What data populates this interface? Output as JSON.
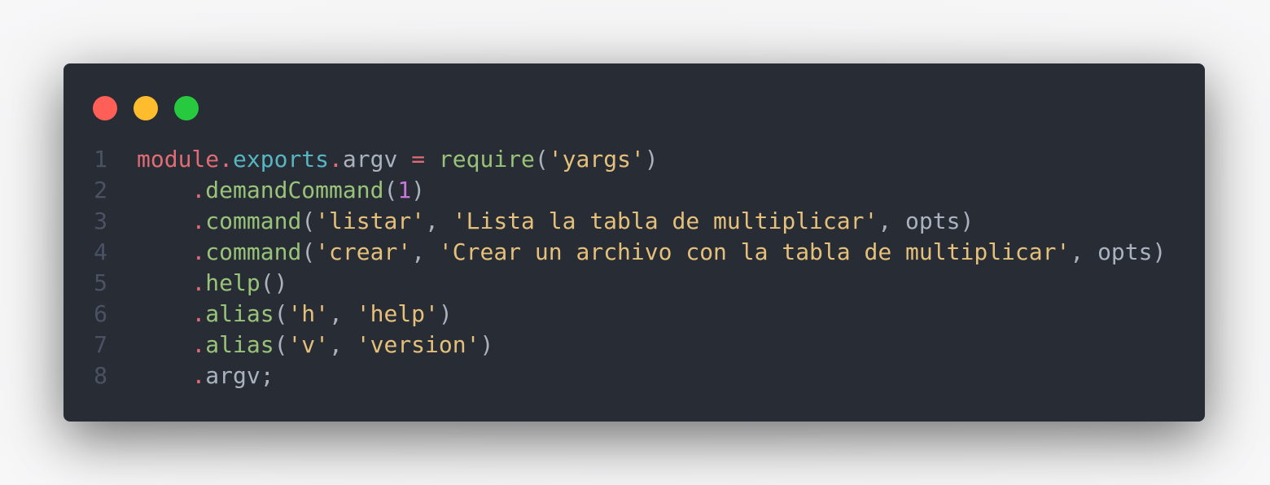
{
  "window": {
    "controls": {
      "close_color": "#ff5f56",
      "minimize_color": "#ffbd2e",
      "maximize_color": "#27c93f"
    }
  },
  "code": {
    "lines": [
      {
        "number": "1",
        "tokens": [
          {
            "text": "module",
            "class": "kw"
          },
          {
            "text": ".",
            "class": "kw"
          },
          {
            "text": "exports",
            "class": "prop"
          },
          {
            "text": ".",
            "class": "kw"
          },
          {
            "text": "argv ",
            "class": "plain"
          },
          {
            "text": "=",
            "class": "op"
          },
          {
            "text": " ",
            "class": "plain"
          },
          {
            "text": "require",
            "class": "fn"
          },
          {
            "text": "(",
            "class": "plain"
          },
          {
            "text": "'yargs'",
            "class": "str"
          },
          {
            "text": ")",
            "class": "plain"
          }
        ]
      },
      {
        "number": "2",
        "tokens": [
          {
            "text": "    ",
            "class": "plain"
          },
          {
            "text": ".",
            "class": "kw"
          },
          {
            "text": "demandCommand",
            "class": "fn"
          },
          {
            "text": "(",
            "class": "plain"
          },
          {
            "text": "1",
            "class": "num"
          },
          {
            "text": ")",
            "class": "plain"
          }
        ]
      },
      {
        "number": "3",
        "tokens": [
          {
            "text": "    ",
            "class": "plain"
          },
          {
            "text": ".",
            "class": "kw"
          },
          {
            "text": "command",
            "class": "fn"
          },
          {
            "text": "(",
            "class": "plain"
          },
          {
            "text": "'listar'",
            "class": "str"
          },
          {
            "text": ", ",
            "class": "plain"
          },
          {
            "text": "'Lista la tabla de multiplicar'",
            "class": "str"
          },
          {
            "text": ", opts)",
            "class": "plain"
          }
        ]
      },
      {
        "number": "4",
        "tokens": [
          {
            "text": "    ",
            "class": "plain"
          },
          {
            "text": ".",
            "class": "kw"
          },
          {
            "text": "command",
            "class": "fn"
          },
          {
            "text": "(",
            "class": "plain"
          },
          {
            "text": "'crear'",
            "class": "str"
          },
          {
            "text": ", ",
            "class": "plain"
          },
          {
            "text": "'Crear un archivo con la tabla de multiplicar'",
            "class": "str"
          },
          {
            "text": ", opts)",
            "class": "plain"
          }
        ]
      },
      {
        "number": "5",
        "tokens": [
          {
            "text": "    ",
            "class": "plain"
          },
          {
            "text": ".",
            "class": "kw"
          },
          {
            "text": "help",
            "class": "fn"
          },
          {
            "text": "()",
            "class": "plain"
          }
        ]
      },
      {
        "number": "6",
        "tokens": [
          {
            "text": "    ",
            "class": "plain"
          },
          {
            "text": ".",
            "class": "kw"
          },
          {
            "text": "alias",
            "class": "fn"
          },
          {
            "text": "(",
            "class": "plain"
          },
          {
            "text": "'h'",
            "class": "str"
          },
          {
            "text": ", ",
            "class": "plain"
          },
          {
            "text": "'help'",
            "class": "str"
          },
          {
            "text": ")",
            "class": "plain"
          }
        ]
      },
      {
        "number": "7",
        "tokens": [
          {
            "text": "    ",
            "class": "plain"
          },
          {
            "text": ".",
            "class": "kw"
          },
          {
            "text": "alias",
            "class": "fn"
          },
          {
            "text": "(",
            "class": "plain"
          },
          {
            "text": "'v'",
            "class": "str"
          },
          {
            "text": ", ",
            "class": "plain"
          },
          {
            "text": "'version'",
            "class": "str"
          },
          {
            "text": ")",
            "class": "plain"
          }
        ]
      },
      {
        "number": "8",
        "tokens": [
          {
            "text": "    ",
            "class": "plain"
          },
          {
            "text": ".",
            "class": "kw"
          },
          {
            "text": "argv;",
            "class": "plain"
          }
        ]
      }
    ]
  }
}
